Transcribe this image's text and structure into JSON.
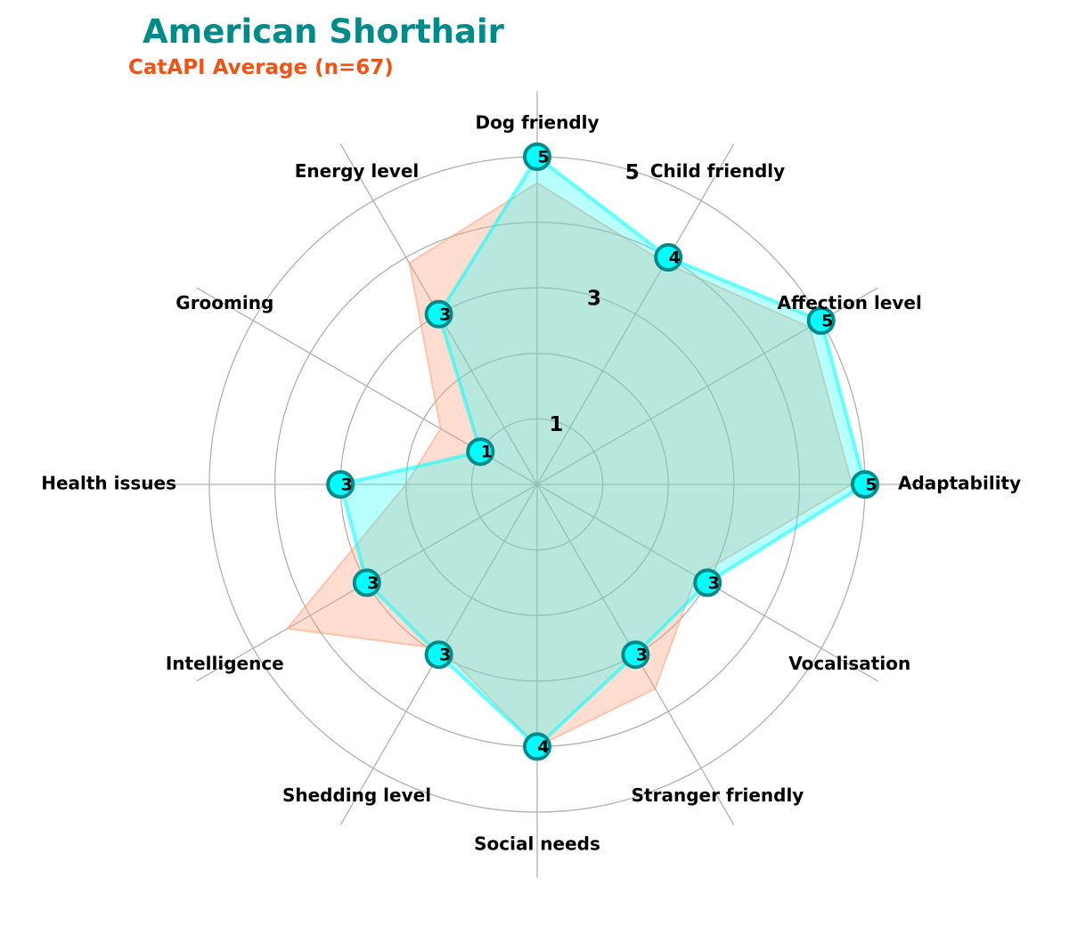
{
  "chart_data": {
    "type": "radar",
    "title": "American Shorthair",
    "subtitle": "CatAPI Average (n=67)",
    "categories": [
      "Adaptability",
      "Affection level",
      "Child friendly",
      "Dog friendly",
      "Energy level",
      "Grooming",
      "Health issues",
      "Intelligence",
      "Shedding level",
      "Social needs",
      "Stranger friendly",
      "Vocalisation"
    ],
    "series": [
      {
        "values": [
          5,
          5,
          4,
          5,
          3,
          1,
          3,
          3,
          3,
          4,
          3,
          3
        ],
        "color": "#00ffff",
        "marker_edge_color": "#008b8b",
        "show_markers": true,
        "show_value_labels": true
      },
      {
        "values": [
          4.8,
          4.8,
          3.9,
          4.6,
          3.9,
          1.7,
          2.0,
          4.4,
          2.9,
          4.0,
          3.6,
          2.8
        ],
        "color": "#ffa07a",
        "show_markers": false,
        "show_value_labels": false
      }
    ],
    "rlim": [
      0,
      5
    ],
    "radial_gridlines": [
      1,
      2,
      3,
      4,
      5
    ],
    "radial_tick_labels": [
      "1",
      "3",
      "5"
    ],
    "grid": true,
    "legend": "none"
  }
}
